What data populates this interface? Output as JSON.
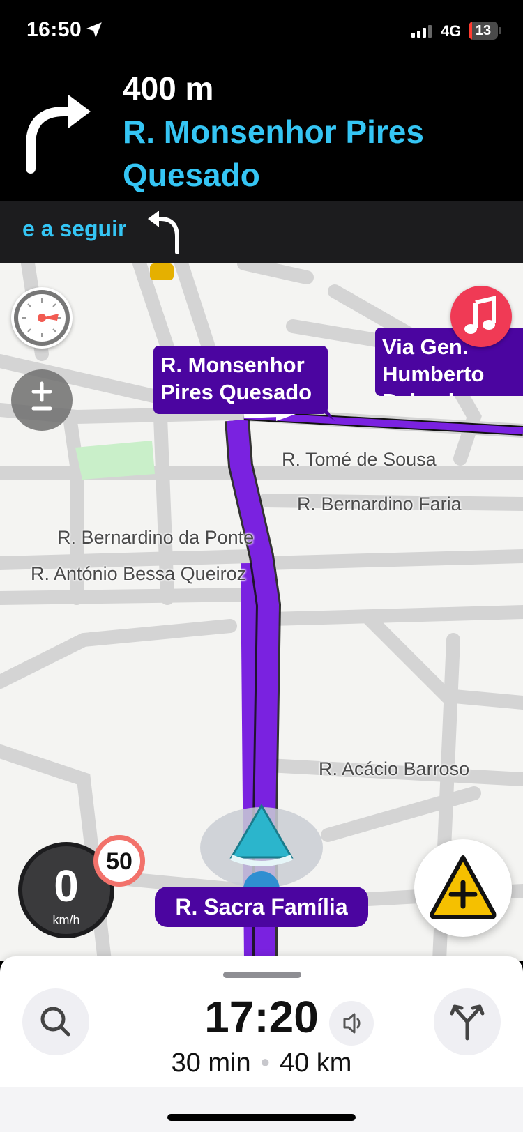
{
  "status_bar": {
    "time": "16:50",
    "network": "4G",
    "battery": "13",
    "battery_level": 0.13
  },
  "instruction": {
    "distance": "400 m",
    "street": "R. Monsenhor Pires Quesado"
  },
  "next_turn": {
    "label": "e a seguir"
  },
  "map": {
    "callouts": {
      "turn_street": "R. Monsenhor Pires Quesado",
      "side_street": "Via Gen. Humberto Delgado"
    },
    "street_labels": [
      "R. Tomé de Sousa",
      "R. Bernardino Faria",
      "R. Bernardino da Ponte",
      "R. António Bessa Queiroz",
      "R. Acácio Barroso"
    ],
    "current_street": "R. Sacra Família"
  },
  "speedometer": {
    "speed": "0",
    "unit": "km/h",
    "limit": "50"
  },
  "trip": {
    "eta": "17:20",
    "duration": "30 min",
    "distance": "40 km"
  },
  "colors": {
    "route": "#7a22e0",
    "callout": "#4b05a0",
    "accent": "#35c5f4",
    "report": "#f5c000"
  }
}
